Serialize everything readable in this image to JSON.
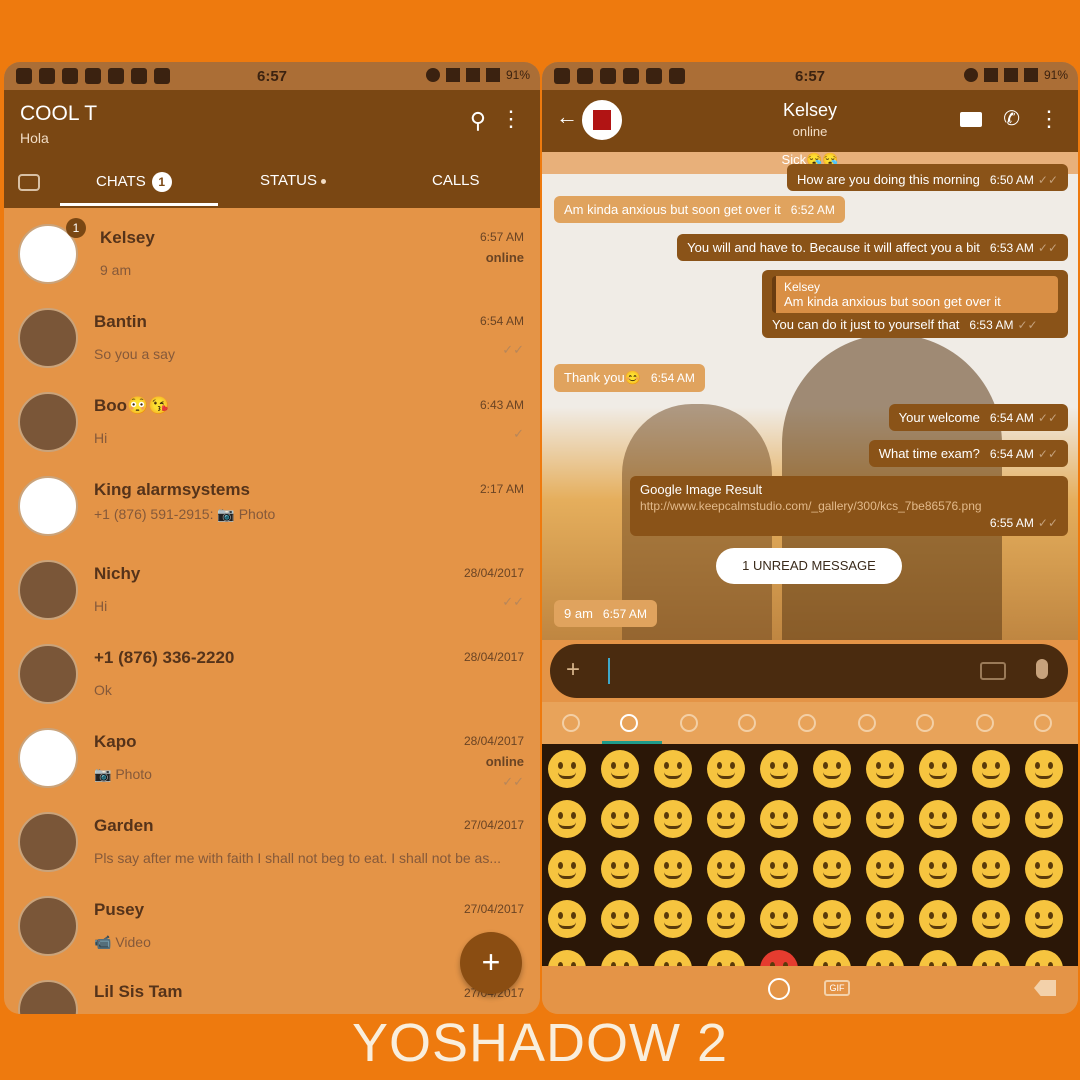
{
  "status_left": {
    "time": "6:57",
    "battery": "91%"
  },
  "status_right": {
    "time": "6:57",
    "battery": "91%"
  },
  "list_header": {
    "title": "COOL T",
    "subtitle": "Hola"
  },
  "tabs": {
    "chats": "CHATS",
    "chats_badge": "1",
    "status": "STATUS",
    "calls": "CALLS"
  },
  "chats": [
    {
      "name": "Kelsey",
      "message": "9 am",
      "time": "6:57 AM",
      "status": "online",
      "unread": "1"
    },
    {
      "name": "Bantin",
      "message": "So you a say",
      "time": "6:54 AM"
    },
    {
      "name": "Boo😳😘",
      "message": "Hi",
      "time": "6:43 AM"
    },
    {
      "name": "King alarmsystems",
      "message": "+1 (876) 591-2915: 📷 Photo",
      "time": "2:17 AM"
    },
    {
      "name": "Nichy",
      "message": "Hi",
      "time": "28/04/2017"
    },
    {
      "name": "+1 (876) 336-2220",
      "message": "Ok",
      "time": "28/04/2017"
    },
    {
      "name": "Kapo",
      "message": "📷 Photo",
      "time": "28/04/2017",
      "status": "online"
    },
    {
      "name": "Garden",
      "message": "Pls say after me with faith I shall not beg to eat. I shall not be as...",
      "time": "27/04/2017"
    },
    {
      "name": "Pusey",
      "message": "📹 Video",
      "time": "27/04/2017"
    },
    {
      "name": "Lil Sis Tam",
      "message": "",
      "time": "27/04/2017"
    }
  ],
  "fab": "+",
  "conversation": {
    "name": "Kelsey",
    "status": "online",
    "sick_note": "Sick😪😪",
    "top_partial": "How are you doing this morning",
    "top_partial_time": "6:50 AM",
    "messages": [
      {
        "text": "Am kinda anxious but soon get over it",
        "time": "6:52 AM"
      },
      {
        "text": "You will and have to. Because it will affect you a bit",
        "time": "6:53 AM"
      },
      {
        "quote_name": "Kelsey",
        "quote_text": "Am kinda anxious but soon get over it",
        "text": "You can do it just to yourself that",
        "time": "6:53 AM"
      },
      {
        "text": "Thank you😊",
        "time": "6:54 AM"
      },
      {
        "text": "Your welcome",
        "time": "6:54 AM"
      },
      {
        "text": "What time exam?",
        "time": "6:54 AM"
      },
      {
        "title": "Google Image Result",
        "text": "http://www.keepcalmstudio.com/_gallery/300/kcs_7be86576.png",
        "time": "6:55 AM"
      },
      {
        "text": "9 am",
        "time": "6:57 AM"
      }
    ],
    "unread_label": "1 UNREAD MESSAGE",
    "plus": "+",
    "gif_label": "GIF"
  },
  "brand": "YOSHADOW 2",
  "colors": {
    "background": "#ee7a0e",
    "header": "#7a4713",
    "list_bg": "#e49447",
    "outgoing": "#8a5318",
    "incoming": "#e0a35e"
  }
}
